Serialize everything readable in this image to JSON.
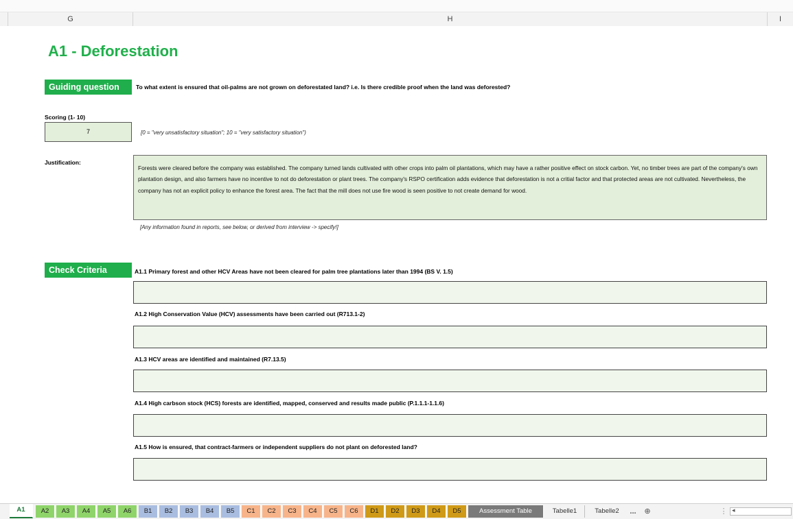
{
  "column_headers": [
    "G",
    "H",
    "I"
  ],
  "title": "A1 - Deforestation",
  "guiding": {
    "label": "Guiding question",
    "question": "To what extent is ensured that oil-palms are not grown on deforestated land? i.e. Is there credible proof when the land was deforested?"
  },
  "scoring": {
    "label": "Scoring (1- 10)",
    "value": "7",
    "scale_note": "[0 = \"very unsatisfactory situation\"; 10 = \"very satisfactory situation\")"
  },
  "justification": {
    "label": "Justification:",
    "text": "Forests were cleared before the company was established. The company turned lands cultivated with other crops into palm oil plantations, which may have a rather positive effect on stock carbon. Yet, no timber trees are part of the company's own plantation design, and also farmers have no incentive to not do deforestation or plant trees. The company's RSPO certification adds evidence that deforestation is not a critial factor and that protected areas are not cultivated. Nevertheless, the company has not an explicit policy to enhance the forest area. The fact that the mill does not use fire wood is seen positive to not create demand for wood.",
    "note": "[Any information found in reports, see below, or derived from interview -> specify!]"
  },
  "check": {
    "label": "Check Criteria",
    "criteria": [
      "A1.1 Primary forest and other HCV Areas have not been cleared for palm tree plantations later than 1994 (BS V. 1.5)",
      "A1.2 High Conservation Value (HCV) assessments have been carried out (R713.1-2)",
      "A1.3 HCV areas are identified and maintained (R7.13.5)",
      "A1.4 High carbson stock (HCS) forests are identified, mapped, conserved and results made public (P.1.1.1-1.1.6)",
      "A1.5 How is ensured, that contract-farmers or independent suppliers do not plant on deforested land?"
    ]
  },
  "tabs": [
    {
      "label": "A1",
      "color": "#ffffff"
    },
    {
      "label": "A2",
      "color": "#8fd46a"
    },
    {
      "label": "A3",
      "color": "#8fd46a"
    },
    {
      "label": "A4",
      "color": "#8fd46a"
    },
    {
      "label": "A5",
      "color": "#8fd46a"
    },
    {
      "label": "A6",
      "color": "#8fd46a"
    },
    {
      "label": "B1",
      "color": "#a9bde0"
    },
    {
      "label": "B2",
      "color": "#a9bde0"
    },
    {
      "label": "B3",
      "color": "#a9bde0"
    },
    {
      "label": "B4",
      "color": "#a9bde0"
    },
    {
      "label": "B5",
      "color": "#a9bde0"
    },
    {
      "label": "C1",
      "color": "#f7b48a"
    },
    {
      "label": "C2",
      "color": "#f7b48a"
    },
    {
      "label": "C3",
      "color": "#f7b48a"
    },
    {
      "label": "C4",
      "color": "#f7b48a"
    },
    {
      "label": "C5",
      "color": "#f7b48a"
    },
    {
      "label": "C6",
      "color": "#f7b48a"
    },
    {
      "label": "D1",
      "color": "#cf9a17"
    },
    {
      "label": "D2",
      "color": "#cf9a17"
    },
    {
      "label": "D3",
      "color": "#cf9a17"
    },
    {
      "label": "D4",
      "color": "#cf9a17"
    },
    {
      "label": "D5",
      "color": "#cf9a17"
    },
    {
      "label": "Assessment Table",
      "color": "#7a7a7a"
    },
    {
      "label": "Tabelle1",
      "color": ""
    },
    {
      "label": "Tabelle2",
      "color": ""
    }
  ],
  "tab_overflow": "...",
  "icons": {
    "add_sheet": "plus-circle-icon",
    "scroll_left": "scroll-left-icon"
  }
}
